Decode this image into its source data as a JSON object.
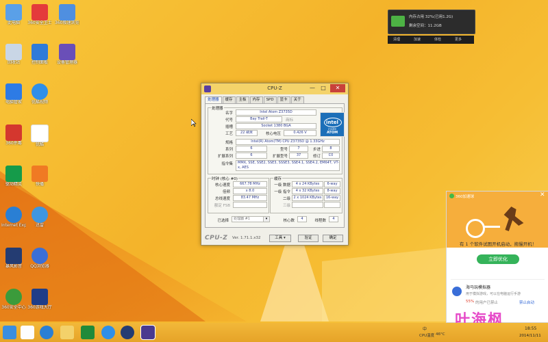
{
  "desktop": {
    "icons": [
      {
        "label": "此电脑",
        "color": "#5aa0e8"
      },
      {
        "label": "360安全卫士",
        "color": "#e43b3b"
      },
      {
        "label": "360极速浏览器",
        "color": "#4f8fe0"
      },
      {
        "label": "回收站",
        "color": "#c9d6e6"
      },
      {
        "label": "控制面板",
        "color": "#2f7bd9"
      },
      {
        "label": "设备管理器",
        "color": "#6a4fb8"
      },
      {
        "label": "电脑管家",
        "color": "#2d7be5"
      },
      {
        "label": "优酷视频",
        "color": "#2f8fe8"
      },
      {
        "label": "360杀毒",
        "color": "#d4372e"
      },
      {
        "label": "优酷",
        "color": "#ffffff"
      },
      {
        "label": "驱动精灵",
        "color": "#159b4a"
      },
      {
        "label": "快播",
        "color": "#f07a23"
      },
      {
        "label": "Internet Explorer",
        "color": "#2a7fd4"
      },
      {
        "label": "迅雷",
        "color": "#3e96e0"
      },
      {
        "label": "暴风影音",
        "color": "#243c72"
      },
      {
        "label": "QQ浏览器",
        "color": "#3b6fd6"
      },
      {
        "label": "360安全中心",
        "color": "#3b9b3b"
      },
      {
        "label": "360游戏大厅",
        "color": "#1f3d88"
      }
    ]
  },
  "cpuz": {
    "title": "CPU-Z",
    "minimize": "—",
    "restore": "□",
    "close": "✕",
    "tabs": [
      "处理器",
      "缓存",
      "主板",
      "内存",
      "SPD",
      "显卡",
      "关于"
    ],
    "processor_group": "处理器",
    "labels": {
      "name": "名字",
      "codename": "代号",
      "package": "插槽",
      "tech": "工艺",
      "voltage": "核心电压",
      "spec": "规格",
      "family": "系列",
      "model": "型号",
      "stepping": "步进",
      "ext_family": "扩展系列",
      "ext_model": "扩展型号",
      "revision": "修订",
      "instructions": "指令集"
    },
    "values": {
      "name": "Intel Atom Z3735D",
      "codename": "Bay Trail-T",
      "brand_id": "商标",
      "package": "Socket 1380 BGA",
      "tech": "22 纳米",
      "voltage": "0.426 V",
      "spec": "Intel(R) Atom(TM) CPU  Z3735D @ 1.33GHz",
      "family": "6",
      "model": "7",
      "stepping": "8",
      "ext_family": "6",
      "ext_model": "37",
      "revision": "C0",
      "instructions": "MMX, SSE, SSE2, SSE3, SSSE3, SSE4.1, SSE4.2, EM64T, VT-x, AES"
    },
    "intel_logo": {
      "brand": "intel",
      "inside": "inside",
      "product": "ATOM"
    },
    "clock_group": "时钟 (核心 #0)",
    "clock_labels": {
      "core_speed": "核心速度",
      "multiplier": "倍频",
      "bus_speed": "总线速度",
      "fsb": "额定 FSB"
    },
    "clock_values": {
      "core_speed": "667.78 MHz",
      "multiplier": "x 8.0",
      "bus_speed": "83.47 MHz",
      "fsb": ""
    },
    "cache_group": "缓存",
    "cache_labels": {
      "l1d": "一级 数据",
      "l1i": "一级 指令",
      "l2": "二级",
      "l3": "三级"
    },
    "cache_values": {
      "l1d": "4 x 24 KBytes",
      "l1d_way": "6-way",
      "l1i": "4 x 32 KBytes",
      "l1i_way": "8-way",
      "l2": "2 x 1024 KBytes",
      "l2_way": "16-way",
      "l3": "",
      "l3_way": ""
    },
    "selection_label": "已选择",
    "selection_value": "处理器 #1",
    "cores_label": "核心数",
    "cores": "4",
    "threads_label": "线程数",
    "threads": "4",
    "logo_text": "CPU-Z",
    "version": "Ver. 1.71.1.x32",
    "tools": "工具",
    "validate": "验证",
    "ok": "确定"
  },
  "widget": {
    "line1": "内存占用 32%(已用1.2G)",
    "line2": "剩余空间：11.2GB",
    "actions": [
      "清理",
      "加速",
      "体检",
      "更多"
    ]
  },
  "popup": {
    "title": "360加速球",
    "close": "✕",
    "message": "有 1 个软件试图开机启动，拖慢开机！",
    "button": "立即优化",
    "item_title": "海马玩模拟器",
    "item_desc": "用于模拟游戏，可以在电脑运行手游",
    "item_percent": "55%",
    "item_rate": "的用户已禁止",
    "item_action": "禁止启动",
    "watermark": "叶海枫"
  },
  "taskbar": {
    "tray_lang": "中",
    "time": "18:55",
    "date": "2014/11/11",
    "cpu_label": "CPU温度",
    "cpu_val": "46°C"
  }
}
